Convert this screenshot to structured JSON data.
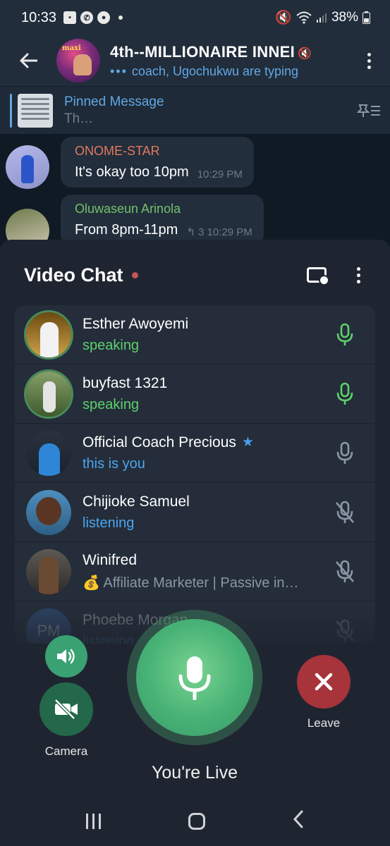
{
  "status_bar": {
    "time": "10:33",
    "battery": "38%",
    "icons": [
      "gallery-icon",
      "whatsapp-icon",
      "microphone-icon",
      "mute-icon",
      "wifi-icon",
      "signal-icon",
      "battery-icon"
    ]
  },
  "header": {
    "title": "4th--MILLIONAIRE INNEI",
    "typing": "coach, Ugochukwu are typing",
    "typing_dots": "•••",
    "avatar_tag": "maxi"
  },
  "pinned": {
    "title": "Pinned Message",
    "preview": "Th…"
  },
  "messages": [
    {
      "sender": "ONOME-STAR",
      "text": "It's okay too 10pm",
      "time": "10:29 PM"
    },
    {
      "sender": "Oluwaseun Arinola",
      "text": "From 8pm-11pm",
      "time": "10:29 PM",
      "replies": "3"
    }
  ],
  "video_chat": {
    "title": "Video Chat",
    "participants": [
      {
        "name": "Esther Awoyemi",
        "status": "speaking",
        "mic": "active"
      },
      {
        "name": "buyfast 1321",
        "status": "speaking",
        "mic": "active"
      },
      {
        "name": "Official Coach Precious",
        "status": "this is you",
        "mic": "open",
        "verified": true
      },
      {
        "name": "Chijioke Samuel",
        "status": "listening",
        "mic": "muted"
      },
      {
        "name": "Winifred",
        "status": "💰 Affiliate Marketer | Passive in…",
        "mic": "muted"
      },
      {
        "name": "Phoebe Morgan",
        "status": "listening",
        "mic": "muted",
        "initials": "PM"
      }
    ],
    "controls": {
      "camera_label": "Camera",
      "live_label": "You're Live",
      "leave_label": "Leave"
    }
  },
  "colors": {
    "accent_blue": "#62a7e3",
    "speaking_green": "#5fcf6e",
    "leave_red": "#a7333b",
    "mic_green": "#47b276"
  }
}
